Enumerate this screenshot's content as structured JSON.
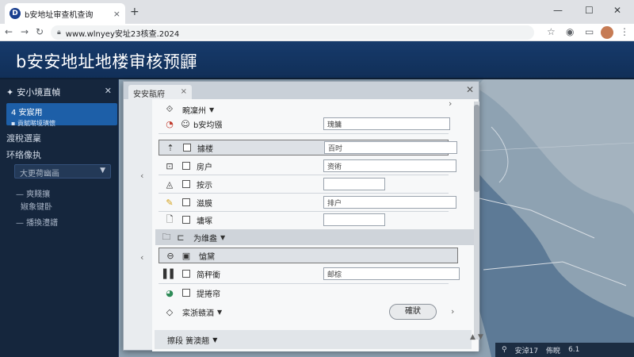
{
  "browser": {
    "tab_title": "b安地址审查机查询",
    "tab_close": "×",
    "new_tab": "+",
    "url": "www.wlnyey安址23核查.2024",
    "minimize": "—",
    "maximize": "☐",
    "close": "✕"
  },
  "app": {
    "title": "b安安地址地楼审核预鼲"
  },
  "sidebar": {
    "header": "安小境直幀",
    "close": "✕",
    "active_line1": "4 安宸用",
    "active_line2": "▪ 貢賦啭境璜懷",
    "items": [
      "渡稅選稟",
      "环络像执"
    ],
    "select_value": "大更荷幽画",
    "sub_items": [
      "— 爽賤攘",
      "婌象键卧",
      "— 播換澧譜"
    ]
  },
  "dialog": {
    "tab_label": "安安瓹府",
    "tab_close": "×",
    "close": "✕",
    "section1_label": "畹凜州",
    "rows": [
      {
        "label": "b安均镪",
        "value": "瑰鳙"
      },
      {
        "label": "據楼",
        "value": "百时"
      },
      {
        "label": "房户",
        "value": "资術"
      },
      {
        "label": "按示",
        "value": ""
      },
      {
        "label": "滋膜",
        "value": "排户"
      },
      {
        "label": "墉塚",
        "value": ""
      }
    ],
    "section2_label": "为维盎",
    "rows2": [
      {
        "label": "愴黛",
        "value": ""
      },
      {
        "label": "简秤衝",
        "value": "邮棕"
      },
      {
        "label": "提捲帘",
        "value": ""
      }
    ],
    "section3_label": "寀浙赣酒",
    "confirm_button": "確狀",
    "footer_label": "擦段 簧澳翘"
  },
  "status": {
    "a": "安淖17",
    "b": "佈睨",
    "c": "6.1"
  }
}
